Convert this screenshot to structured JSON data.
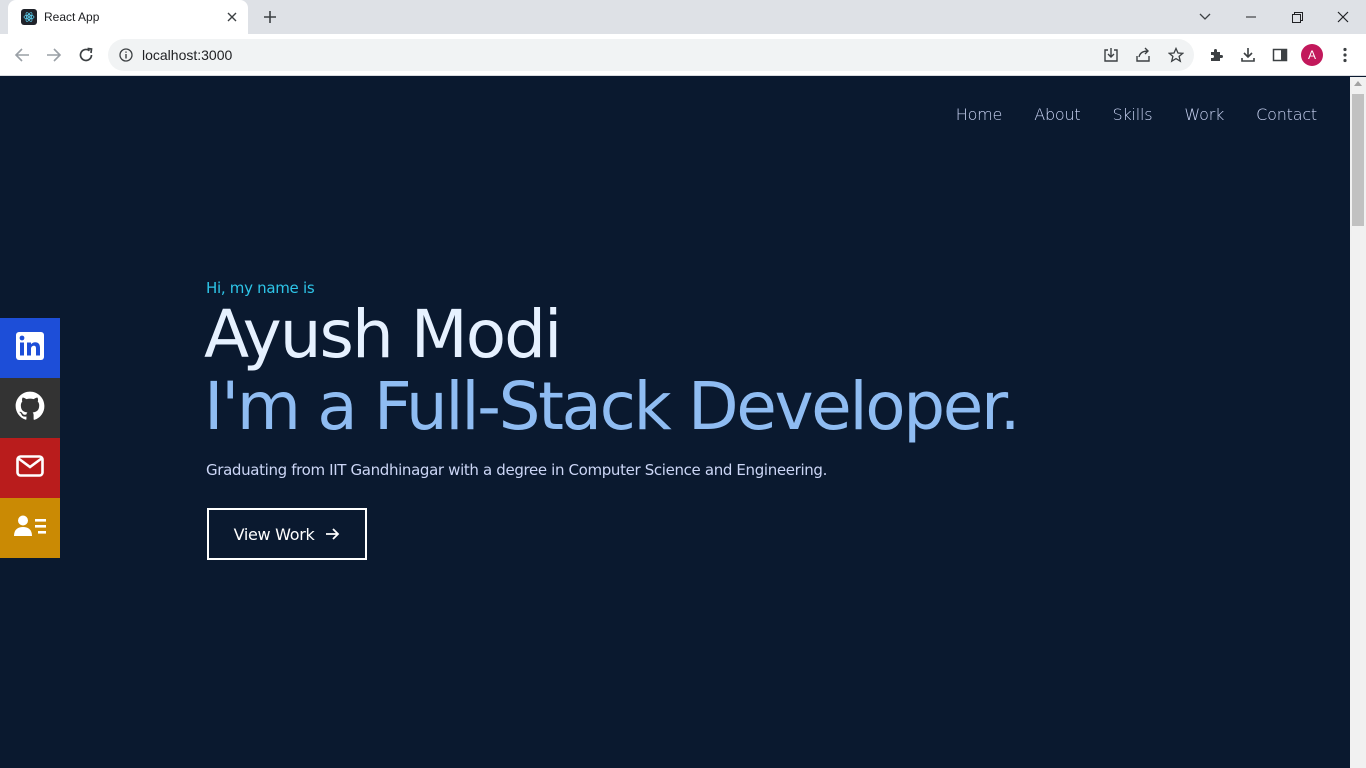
{
  "browser": {
    "tab_title": "React App",
    "url": "localhost:3000",
    "profile_initial": "A"
  },
  "nav": {
    "items": [
      "Home",
      "About",
      "Skills",
      "Work",
      "Contact"
    ]
  },
  "hero": {
    "greeting": "Hi, my name is",
    "name": "Ayush Modi",
    "role": "I'm a Full-Stack Developer.",
    "description": "Graduating from IIT Gandhinagar with a degree in Computer Science and Engineering.",
    "cta_label": "View Work"
  },
  "social": [
    {
      "icon": "linkedin-icon",
      "color": "#1d4ed8"
    },
    {
      "icon": "github-icon",
      "color": "#333333"
    },
    {
      "icon": "mail-icon",
      "color": "#b91c1c"
    },
    {
      "icon": "resume-icon",
      "color": "#ca8a04"
    }
  ],
  "colors": {
    "background": "#0a192f",
    "accent_cyan": "#2ec5e8",
    "role_blue": "#8fbcf2"
  }
}
